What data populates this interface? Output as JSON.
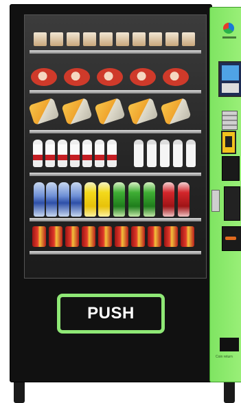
{
  "push_panel": {
    "label": "PUSH"
  },
  "side_panel": {
    "bottom_label": "Coin return"
  },
  "colors": {
    "accent_green": "#8fe876",
    "cabinet": "#111111"
  },
  "icons": [
    "logo-icon",
    "touch-screen",
    "keypad",
    "card-reader",
    "bill-acceptor",
    "coin-return",
    "coin-tray"
  ],
  "shelves": [
    {
      "row": 1,
      "product": "cups"
    },
    {
      "row": 2,
      "product": "instant noodles"
    },
    {
      "row": 3,
      "product": "snack bags"
    },
    {
      "row": 4,
      "product": "small bottles"
    },
    {
      "row": 5,
      "product": "large bottles"
    },
    {
      "row": 6,
      "product": "cans"
    }
  ]
}
